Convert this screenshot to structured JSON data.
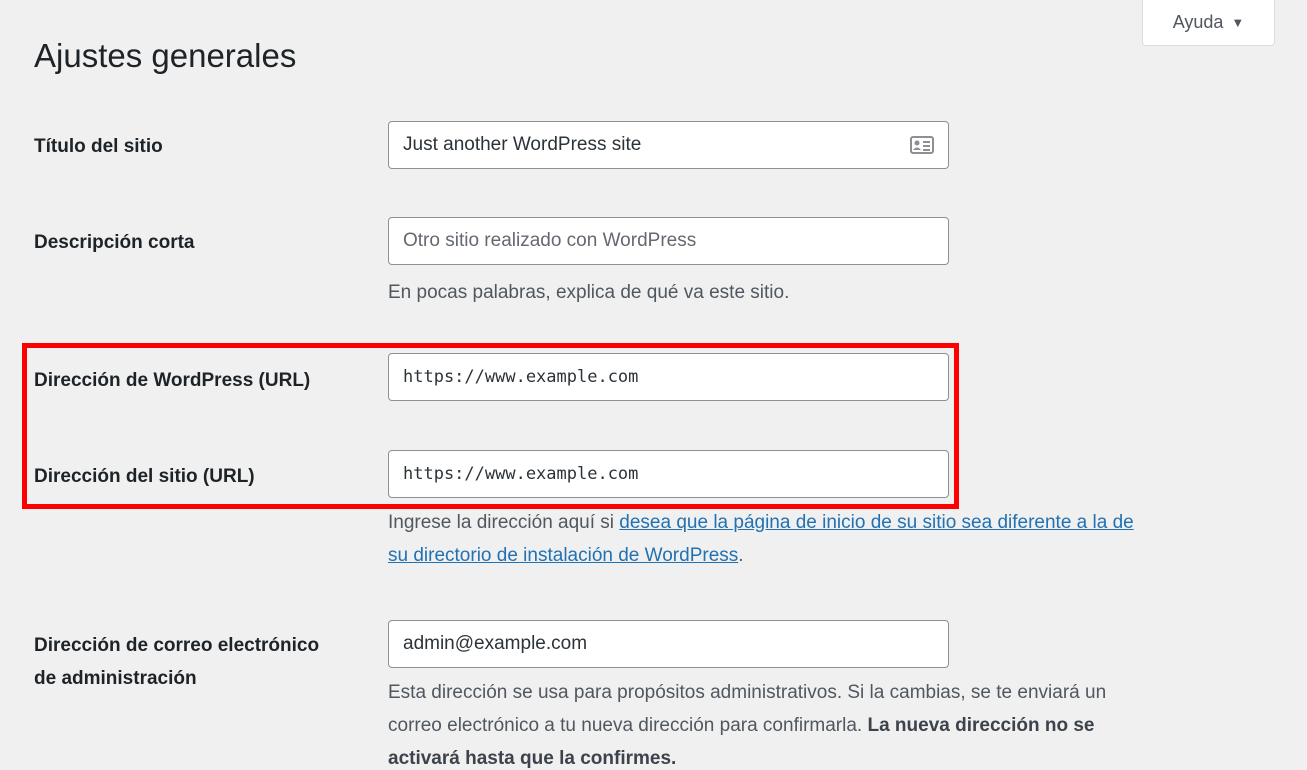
{
  "help_tab": {
    "label": "Ayuda",
    "caret": "▼"
  },
  "page_title": "Ajustes generales",
  "fields": {
    "site_title": {
      "label": "Título del sitio",
      "value": "Just another WordPress site"
    },
    "tagline": {
      "label": "Descripción corta",
      "placeholder": "Otro sitio realizado con WordPress",
      "description": "En pocas palabras, explica de qué va este sitio."
    },
    "wp_url": {
      "label": "Dirección de WordPress (URL)",
      "value": "https://www.example.com"
    },
    "site_url": {
      "label": "Dirección del sitio (URL)",
      "value": "https://www.example.com",
      "description_prefix": "Ingrese la dirección aquí si ",
      "description_link_line1": "desea que la página de inicio de su sitio sea diferente a la de",
      "description_link_line2": "su directorio de instalación de WordPress",
      "description_suffix": "."
    },
    "admin_email": {
      "label_line1": "Dirección de correo electrónico",
      "label_line2": "de administración",
      "value": "admin@example.com",
      "description_line1": "Esta dirección se usa para propósitos administrativos. Si la cambias, se te enviará un",
      "description_line2": "correo electrónico a tu nueva dirección para confirmarla.",
      "description_bold_line2": "La nueva dirección no se",
      "description_bold_line3": "activará hasta que la confirmes."
    }
  },
  "colors": {
    "highlight": "#ff0000",
    "link": "#2271b1",
    "background": "#f0f0f1"
  },
  "icons": {
    "site_title_field": "contact-card-icon"
  }
}
